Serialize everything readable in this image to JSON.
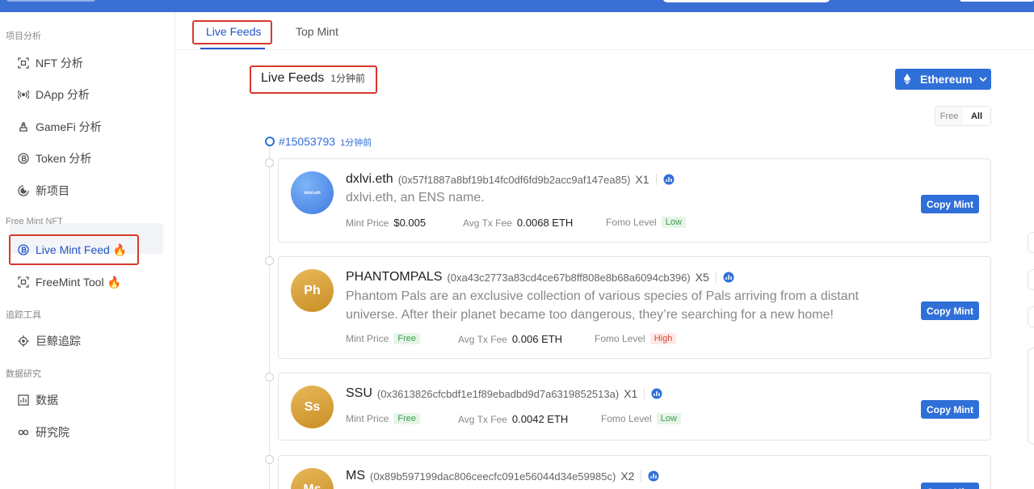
{
  "sidebar": {
    "groups": [
      {
        "label": "项目分析"
      },
      {
        "label": "Free Mint NFT"
      },
      {
        "label": "追踪工具"
      },
      {
        "label": "数据研究"
      }
    ],
    "items": [
      {
        "label": "NFT 分析",
        "icon": "scan-icon"
      },
      {
        "label": "DApp 分析",
        "icon": "broadcast-icon"
      },
      {
        "label": "GameFi 分析",
        "icon": "game-icon"
      },
      {
        "label": "Token 分析",
        "icon": "coin-icon"
      },
      {
        "label": "新项目",
        "icon": "new-project-icon"
      },
      {
        "label": "Live Mint Feed 🔥",
        "icon": "coin-icon"
      },
      {
        "label": "FreeMint Tool 🔥",
        "icon": "scan-icon"
      },
      {
        "label": "巨鲸追踪",
        "icon": "target-icon"
      },
      {
        "label": "数据",
        "icon": "chart-icon"
      },
      {
        "label": "研究院",
        "icon": "infinity-icon"
      }
    ]
  },
  "tabs": [
    {
      "label": "Live Feeds"
    },
    {
      "label": "Top Mint"
    }
  ],
  "feed": {
    "title": "Live Feeds",
    "updated": "1分钟前",
    "chain": "Ethereum",
    "filter": [
      "Free",
      "All"
    ],
    "block": {
      "number": "#15053793",
      "ago": "1分钟前"
    }
  },
  "labels": {
    "mint_price": "Mint Price",
    "avg_tx_fee": "Avg Tx Fee",
    "fomo_level": "Fomo Level",
    "copy_mint": "Copy Mint"
  },
  "cards": [
    {
      "name": "dxlvi.eth",
      "address": "(0x57f1887a8bf19b14fc0df6fd9b2acc9af147ea85)",
      "multiplier": "X1",
      "description": "dxlvi.eth, an ENS name.",
      "avatar": "",
      "avatar_text": "dxlvi.eth",
      "mint_price": "$0.005",
      "avg_tx_fee": "0.0068 ETH",
      "fomo_level": "Low"
    },
    {
      "name": "PHANTOMPALS",
      "address": "(0xa43c2773a83cd4ce67b8ff808e8b68a6094cb396)",
      "multiplier": "X5",
      "description": "Phantom Pals are an exclusive collection of various species of Pals arriving from a distant universe. After their planet became too dangerous, they’re searching for a new home!",
      "avatar": "Ph",
      "mint_price": "Free",
      "avg_tx_fee": "0.006 ETH",
      "fomo_level": "High"
    },
    {
      "name": "SSU",
      "address": "(0x3613826cfcbdf1e1f89ebadbd9d7a6319852513a)",
      "multiplier": "X1",
      "description": "",
      "avatar": "Ss",
      "mint_price": "Free",
      "avg_tx_fee": "0.0042 ETH",
      "fomo_level": "Low"
    },
    {
      "name": "MS",
      "address": "(0x89b597199dac806ceecfc091e56044d34e59985c)",
      "multiplier": "X2",
      "description": "",
      "avatar": "Ms"
    }
  ],
  "colors": {
    "primary": "#2f6fd8",
    "highlight": "#d9382b",
    "fomo_low_bg": "#e7f5e8",
    "fomo_high_bg": "#fde9e6"
  }
}
